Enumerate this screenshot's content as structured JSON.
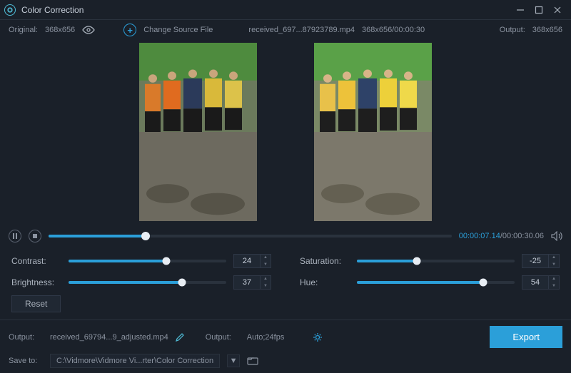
{
  "titlebar": {
    "title": "Color Correction"
  },
  "info": {
    "original_label": "Original:",
    "original_dims": "368x656",
    "change_source": "Change Source File",
    "filename": "received_697...87923789.mp4",
    "file_meta": "368x656/00:00:30",
    "output_label": "Output:",
    "output_dims": "368x656"
  },
  "playback": {
    "current": "00:00:07.14",
    "total": "/00:00:30.06",
    "seek_pct": 24
  },
  "sliders": {
    "contrast": {
      "label": "Contrast:",
      "value": "24",
      "pct": 62
    },
    "brightness": {
      "label": "Brightness:",
      "value": "37",
      "pct": 72
    },
    "saturation": {
      "label": "Saturation:",
      "value": "-25",
      "pct": 38
    },
    "hue": {
      "label": "Hue:",
      "value": "54",
      "pct": 80
    }
  },
  "reset": {
    "label": "Reset"
  },
  "output_row": {
    "label1": "Output:",
    "filename": "received_69794...9_adjusted.mp4",
    "label2": "Output:",
    "format": "Auto;24fps"
  },
  "save_row": {
    "label": "Save to:",
    "path": "C:\\Vidmore\\Vidmore Vi...rter\\Color Correction"
  },
  "export": {
    "label": "Export"
  }
}
